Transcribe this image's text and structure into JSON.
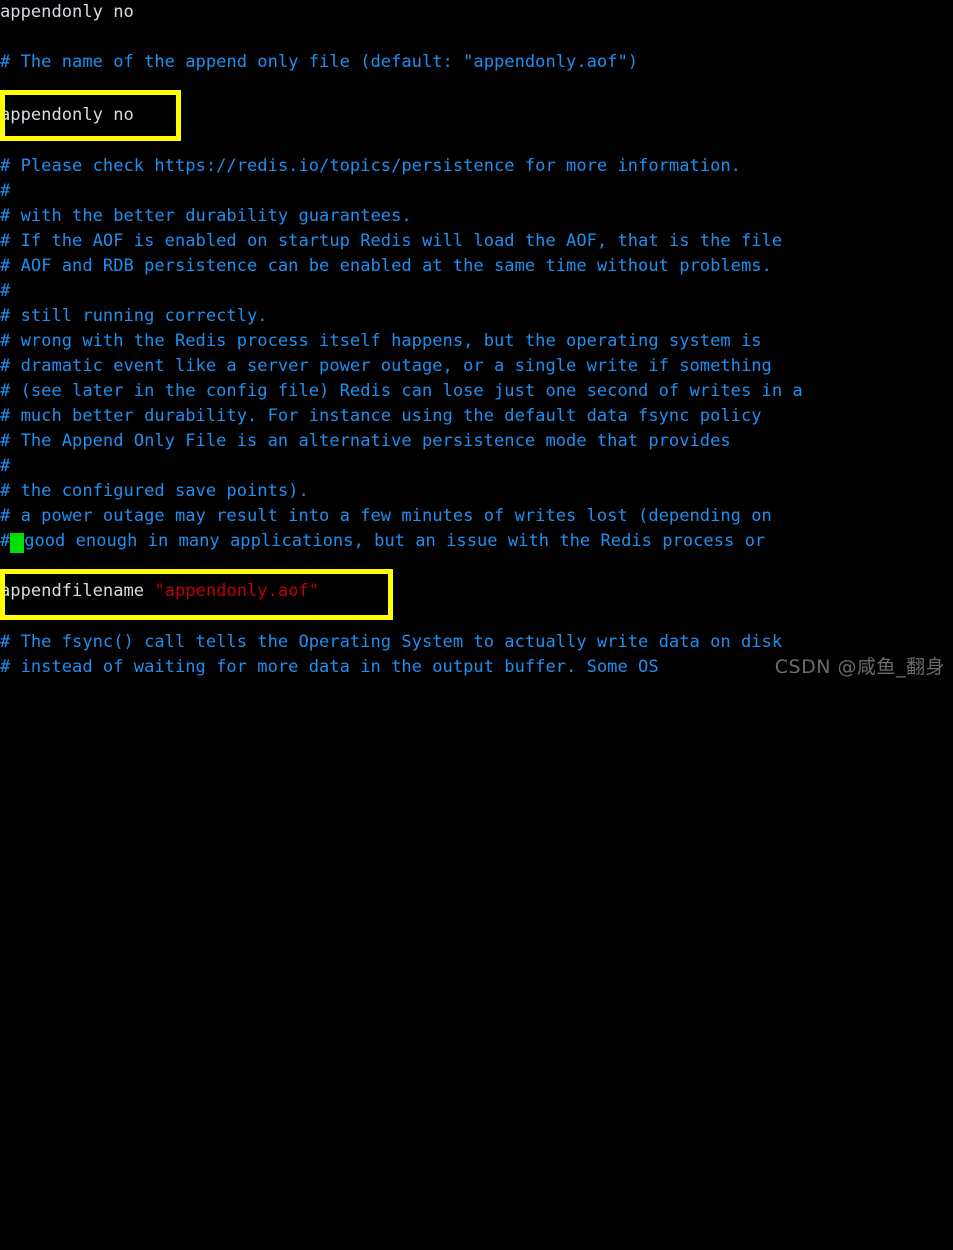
{
  "terminal": {
    "background_color": "#000000",
    "comment_color": "#1f8fef",
    "text_color": "#d6dbe4",
    "string_color": "#c10000",
    "cursor_color": "#00e000",
    "highlight_color": "#ffff00",
    "lines": [
      {
        "id": "l1",
        "text": "appendonly no",
        "style": "wht"
      },
      {
        "id": "l2",
        "text": "",
        "style": "blank"
      },
      {
        "id": "l3",
        "text": "# The name of the append only file (default: \"appendonly.aof\")",
        "style": "cmt"
      },
      {
        "id": "l4",
        "text": "appendonly no",
        "style": "wht"
      },
      {
        "id": "l5",
        "text": "",
        "style": "blank"
      },
      {
        "id": "l6",
        "text": "# Please check https://redis.io/topics/persistence for more information.",
        "style": "cmt"
      },
      {
        "id": "l7",
        "text": "#",
        "style": "cmt"
      },
      {
        "id": "l8",
        "text": "# with the better durability guarantees.",
        "style": "cmt"
      },
      {
        "id": "l9",
        "text": "# If the AOF is enabled on startup Redis will load the AOF, that is the file",
        "style": "cmt"
      },
      {
        "id": "l10",
        "text": "# AOF and RDB persistence can be enabled at the same time without problems.",
        "style": "cmt"
      },
      {
        "id": "l11",
        "text": "#",
        "style": "cmt"
      },
      {
        "id": "l12",
        "text": "# still running correctly.",
        "style": "cmt"
      },
      {
        "id": "l13",
        "text": "# wrong with the Redis process itself happens, but the operating system is",
        "style": "cmt"
      },
      {
        "id": "l14",
        "text": "# dramatic event like a server power outage, or a single write if something",
        "style": "cmt"
      },
      {
        "id": "l15",
        "text": "# (see later in the config file) Redis can lose just one second of writes in a",
        "style": "cmt"
      },
      {
        "id": "l16",
        "text": "# much better durability. For instance using the default data fsync policy",
        "style": "cmt"
      },
      {
        "id": "l17",
        "text": "# The Append Only File is an alternative persistence mode that provides",
        "style": "cmt"
      },
      {
        "id": "l18",
        "text": "#",
        "style": "cmt"
      },
      {
        "id": "l19",
        "text": "# the configured save points).",
        "style": "cmt"
      },
      {
        "id": "l20",
        "text": "# a power outage may result into a few minutes of writes lost (depending on",
        "style": "cmt"
      },
      {
        "id": "l21",
        "text": "# good enough in many applications, but an issue with the Redis process or",
        "style": "cmt"
      },
      {
        "id": "l22",
        "text": "",
        "style": "blank"
      },
      {
        "id": "l23",
        "text": "appendfilename ",
        "style": "wht"
      },
      {
        "id": "l24",
        "text": "",
        "style": "blank"
      },
      {
        "id": "l25",
        "text": "# The fsync() call tells the Operating System to actually write data on disk",
        "style": "cmt"
      },
      {
        "id": "l26",
        "text": "# instead of waiting for more data in the output buffer. Some OS",
        "style": "cmt"
      }
    ],
    "appendfilename_directive": "appendfilename ",
    "appendfilename_value": "\"appendonly.aof\"",
    "cursor_line_prefix": "#",
    "cursor_line_suffix": "good enough in many applications, but an issue with the Redis process or"
  },
  "highlights": [
    {
      "id": "hl1",
      "label": "appendonly-no-highlight"
    },
    {
      "id": "hl2",
      "label": "appendfilename-highlight"
    }
  ],
  "watermark": {
    "text": "CSDN @咸鱼_翻身"
  }
}
